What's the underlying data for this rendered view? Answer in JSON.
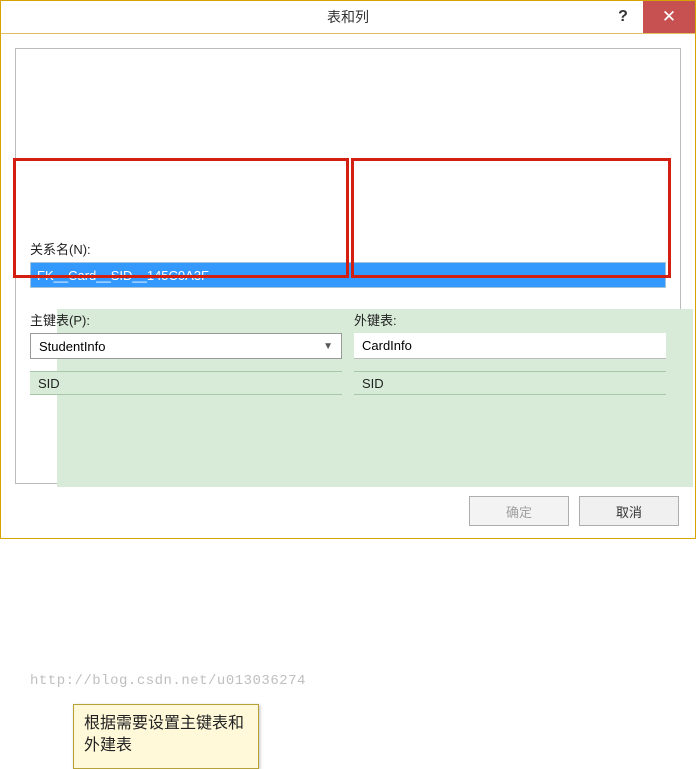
{
  "window": {
    "title": "表和列",
    "help_symbol": "?",
    "close_symbol": "✕"
  },
  "relation": {
    "label": "关系名(N):",
    "value": "FK__Card__SID__145C0A3F"
  },
  "primary_table": {
    "label": "主键表(P):",
    "selected": "StudentInfo",
    "column": "SID"
  },
  "foreign_table": {
    "label": "外键表:",
    "name": "CardInfo",
    "column": "SID"
  },
  "callout": {
    "text": "根据需要设置主键表和外建表"
  },
  "watermark": "http://blog.csdn.net/u013036274",
  "buttons": {
    "ok": "确定",
    "cancel": "取消"
  }
}
